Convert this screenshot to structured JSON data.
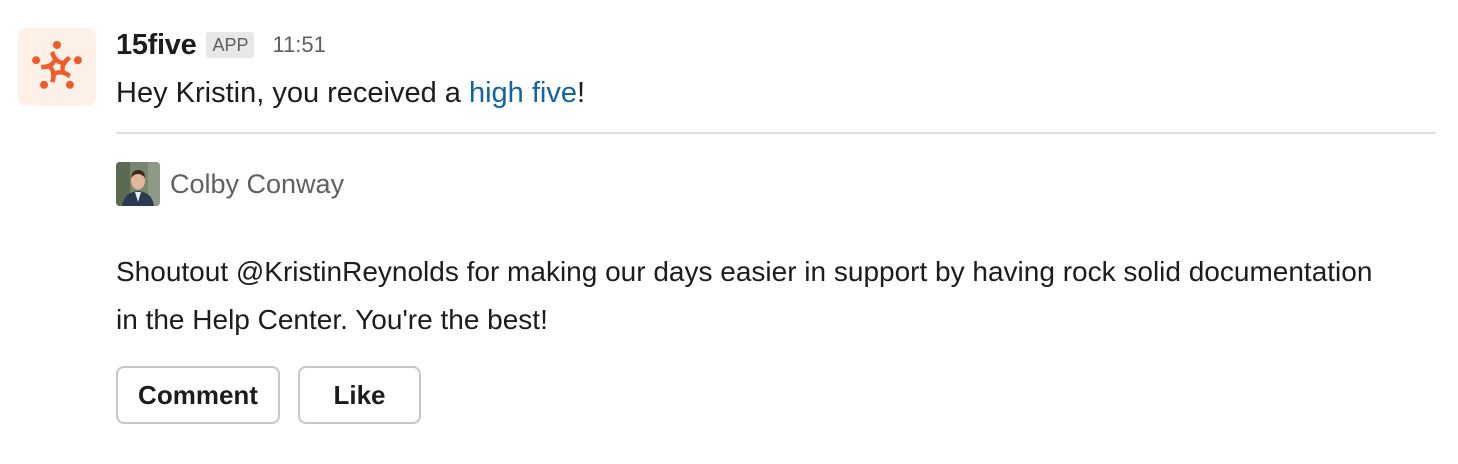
{
  "app": {
    "icon": "15five-logo-icon",
    "brand_color": "#f15a29",
    "avatar_bg": "#fdf0e6"
  },
  "header": {
    "sender_name": "15five",
    "badge": "APP",
    "timestamp": "11:51"
  },
  "greeting": {
    "prefix": "Hey Kristin, you received a ",
    "link_text": "high five",
    "suffix": "!",
    "link_color": "#1264a3"
  },
  "attachment": {
    "author_name": "Colby Conway",
    "author_avatar": "user-photo-avatar",
    "message": "Shoutout @KristinReynolds for making our days easier in support by having rock solid documentation in the Help Center. You're the best!"
  },
  "actions": {
    "comment_label": "Comment",
    "like_label": "Like"
  }
}
